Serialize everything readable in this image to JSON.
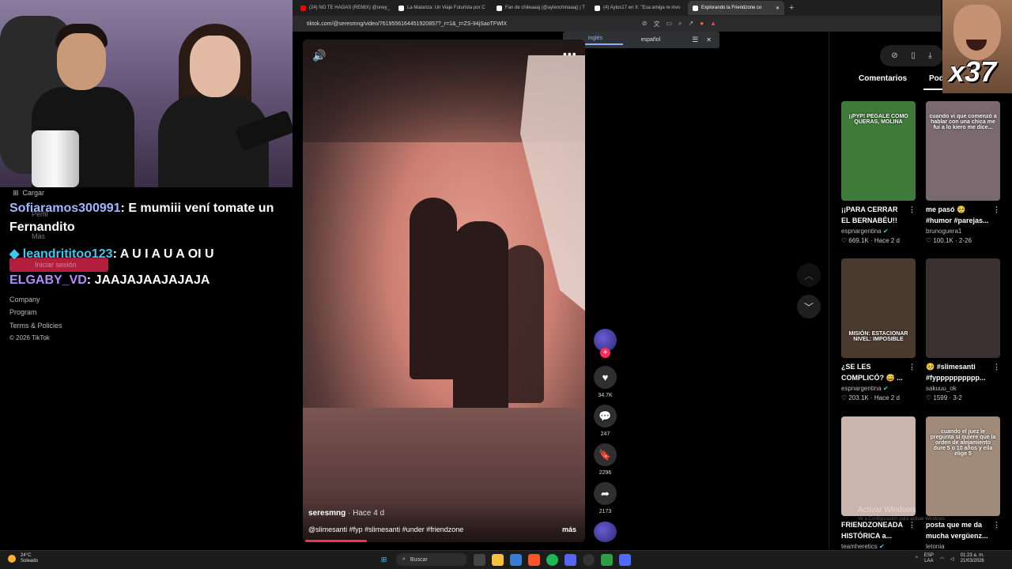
{
  "browser": {
    "tabs": [
      {
        "label": "(24) NO TE HAGAS (REMIX) @oney_",
        "color": "#ff0000"
      },
      {
        "label": "La Matanza: Un Viaje Futurista por C",
        "color": "#ffffff"
      },
      {
        "label": "Fan de chileaaaj (@aylenchinaaaj) | T",
        "color": "#ffffff"
      },
      {
        "label": "(4) Aylus17 en X: \"Esa amiga re invo",
        "color": "#ffffff"
      },
      {
        "label": "Explorando la Friendzone co",
        "color": "#ffffff"
      }
    ],
    "url": "tiktok.com/@seresmng/video/7619556164451920857?_r=1&_t=ZS-94jSaoTFWlX",
    "translate": {
      "lang1": "inglés",
      "lang2": "español"
    }
  },
  "stream_overlay": {
    "chat": [
      {
        "user": "Sofiaramos300991",
        "message": "E mumiii vení tomate un Fernandito"
      },
      {
        "user": "leandrititoo123",
        "message": "A U I A U A OI U"
      },
      {
        "user": "ELGABY_VD",
        "message": "JAAJAJAAJAJAJA"
      }
    ],
    "multiplier": "x37"
  },
  "tiktok_sidebar": {
    "cargar": "Cargar",
    "perfil": "Perfil",
    "mas": "Más",
    "login": "Iniciar sesión",
    "links": [
      "Company",
      "Program",
      "Terms & Policies"
    ],
    "copyright": "© 2026 TikTok"
  },
  "video": {
    "author": "seresmng",
    "time": "· Hace 4 d",
    "description": "@slimesanti #fyp #slimesanti #under #friendzone",
    "more": "más",
    "progress": 0.22,
    "likes": "34.7K",
    "comments": "247",
    "saves": "2296",
    "shares": "2173"
  },
  "right_panel": {
    "tab_comments": "Comentarios",
    "tab_suggest": "Podrías",
    "cards": [
      {
        "title": "¡¡PARA CERRAR EL BERNABÉU!! 🤯 ...",
        "author": "espnargentina",
        "verified": true,
        "likes": "669.1K",
        "age": "Hace 2 d",
        "overlay": "¡¡PYP! PEGALE COMO QUERAS, MOLINA",
        "bg": "#3f7a3a"
      },
      {
        "title": "me pasó 🥺 #humor #parejas...",
        "author": "brunoguera1",
        "verified": false,
        "likes": "100.1K",
        "age": "2-26",
        "overlay": "cuando vi que comenzó a hablar con una chica me fui a lo kiero me dice...",
        "bg": "#7a6a70"
      },
      {
        "title": "¿SE LES COMPLICÓ? 😅 ...",
        "author": "espnargentina",
        "verified": true,
        "likes": "203.1K",
        "age": "Hace 2 d",
        "overlay": "MISIÓN: ESTACIONAR NIVEL: IMPOSIBLE",
        "bg": "#4a3a30"
      },
      {
        "title": "🥺 #slimesanti #fypppppppppp...",
        "author": "sakuuu_ok",
        "verified": false,
        "likes": "1599",
        "age": "3-2",
        "overlay": "",
        "bg": "#3a3030"
      },
      {
        "title": "FRIENDZONEADA HISTÓRICA a...",
        "author": "teamheretics",
        "verified": true,
        "likes": "",
        "age": "",
        "overlay": "",
        "bg": "#c9b5ad"
      },
      {
        "title": "posta que me da mucha vergüenz...",
        "author": "letonia",
        "verified": false,
        "likes": "",
        "age": "",
        "overlay": "cuando el juez le pregunta si quiere que la orden de alejamiento dure 5 o 10 años y ella elige 5",
        "bg": "#a08a7a"
      }
    ]
  },
  "watermark": {
    "line1": "Activar Windows",
    "line2": "Ve a Configuración para activar Windows."
  },
  "taskbar": {
    "temp": "24°C",
    "weather": "Soleado",
    "search": "Buscar",
    "lang1": "ESP",
    "lang2": "LAA",
    "time": "01:23 a. m.",
    "date": "21/03/2026"
  }
}
